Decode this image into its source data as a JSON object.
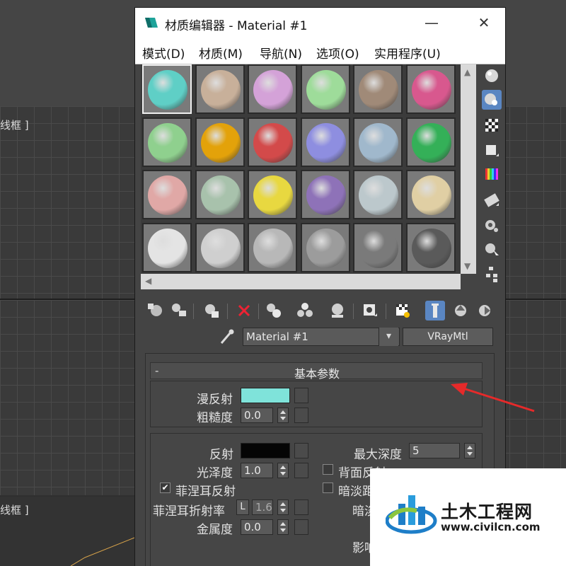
{
  "window": {
    "title": "材质编辑器 - Material #1",
    "minimize_glyph": "—",
    "maximize_glyph": "☐",
    "close_glyph": "✕"
  },
  "menu": [
    {
      "label": "模式(D)"
    },
    {
      "label": "材质(M)"
    },
    {
      "label": "导航(N)"
    },
    {
      "label": "选项(O)"
    },
    {
      "label": "实用程序(U)"
    }
  ],
  "viewports": {
    "top_label": "线框 ]",
    "bottom_label": "线框 ]"
  },
  "sample_slots": [
    {
      "color": "#5fcfc6",
      "selected": true
    },
    {
      "color": "#c8b09a"
    },
    {
      "color": "#d4a2d8"
    },
    {
      "color": "#9edc9a"
    },
    {
      "color": "#a08a78"
    },
    {
      "color": "#d8588e"
    },
    {
      "color": "#8fd08e"
    },
    {
      "color": "#e3a20a"
    },
    {
      "color": "#d34a4a"
    },
    {
      "color": "#8e8ee0"
    },
    {
      "color": "#a0b8cc"
    },
    {
      "color": "#34b058"
    },
    {
      "color": "#e0a8a6"
    },
    {
      "color": "#a8c2ac"
    },
    {
      "color": "#e8d840"
    },
    {
      "color": "#8e72b8"
    },
    {
      "color": "#bcc8cc"
    },
    {
      "color": "#e0cfa4"
    },
    {
      "color": "#e4e4e4"
    },
    {
      "color": "#cfcfcf"
    },
    {
      "color": "#b8b8b8"
    },
    {
      "color": "#9c9c9c"
    },
    {
      "color": "#7a7a7a"
    },
    {
      "color": "#5a5a5a"
    }
  ],
  "side_tools": [
    {
      "icon": "sample-type-sphere-icon"
    },
    {
      "icon": "backlight-icon",
      "active": true
    },
    {
      "icon": "background-checker-icon"
    },
    {
      "icon": "sample-uv-tiling-icon"
    },
    {
      "icon": "video-color-check-icon"
    },
    {
      "icon": "make-preview-icon"
    },
    {
      "icon": "options-icon"
    },
    {
      "icon": "select-by-material-icon"
    },
    {
      "icon": "material-map-navigator-icon"
    }
  ],
  "bottom_tools": [
    {
      "icon": "get-material-icon"
    },
    {
      "icon": "put-to-scene-icon"
    },
    {
      "icon": "assign-to-selection-icon"
    },
    {
      "icon": "reset-map-icon"
    },
    {
      "icon": "make-copy-icon"
    },
    {
      "icon": "make-unique-icon"
    },
    {
      "icon": "put-to-library-icon"
    },
    {
      "icon": "material-id-channel-icon"
    },
    {
      "icon": "show-shaded-in-viewport-icon"
    },
    {
      "icon": "show-end-result-icon",
      "active": true
    },
    {
      "icon": "go-to-parent-icon"
    },
    {
      "icon": "go-forward-to-sibling-icon"
    }
  ],
  "material": {
    "name": "Material #1",
    "type": "VRayMtl"
  },
  "basic_params": {
    "header": "基本参数",
    "collapse": "-",
    "diffuse_label": "漫反射",
    "diffuse_color": "#7fe3da",
    "roughness_label": "粗糙度",
    "roughness_value": "0.0",
    "reflect_label": "反射",
    "reflect_color": "#050505",
    "glossiness_label": "光泽度",
    "glossiness_value": "1.0",
    "fresnel_label": "菲涅耳反射",
    "fresnel_checked": "✔",
    "fresnel_ior_label": "菲涅耳折射率",
    "fresnel_ior_lock": "L",
    "fresnel_ior_value": "1.6",
    "metalness_label": "金属度",
    "metalness_value": "0.0",
    "max_depth_label": "最大深度",
    "max_depth_value": "5",
    "back_reflect_label": "背面反射",
    "dim_distance_label": "暗淡距离",
    "dim_falloff_label": "暗淡",
    "affect_label": "影响"
  },
  "watermark": {
    "title": "土木工程网",
    "url": "www.civilcn.com"
  }
}
